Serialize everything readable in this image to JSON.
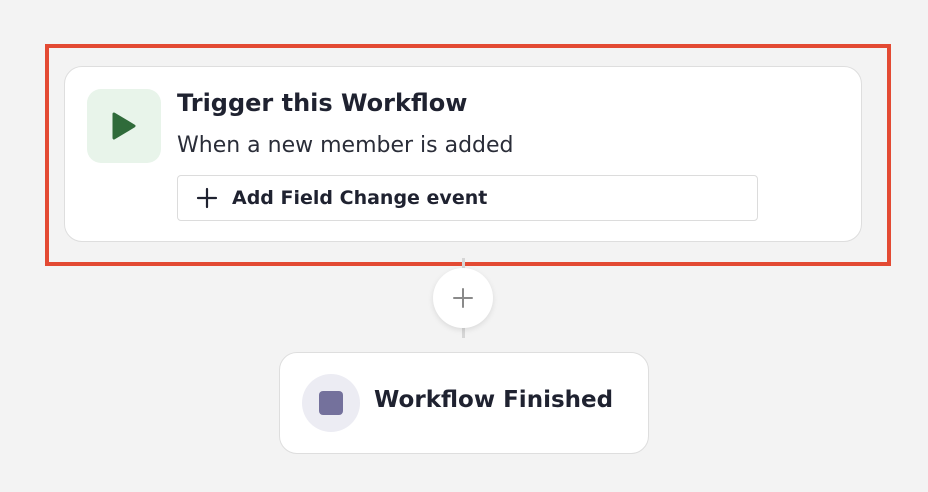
{
  "trigger": {
    "title": "Trigger this Workflow",
    "subtitle": "When a new member is added",
    "add_field_label": "Add Field Change event",
    "icon": "play-icon"
  },
  "finish": {
    "label": "Workflow Finished",
    "icon": "stop-icon"
  },
  "add_step": {
    "icon": "plus-icon"
  },
  "colors": {
    "highlight_border": "#e34a33",
    "play": "#2f6b3a",
    "play_bg": "#e8f4ea",
    "stop": "#74719c",
    "stop_bg": "#ececf3"
  }
}
